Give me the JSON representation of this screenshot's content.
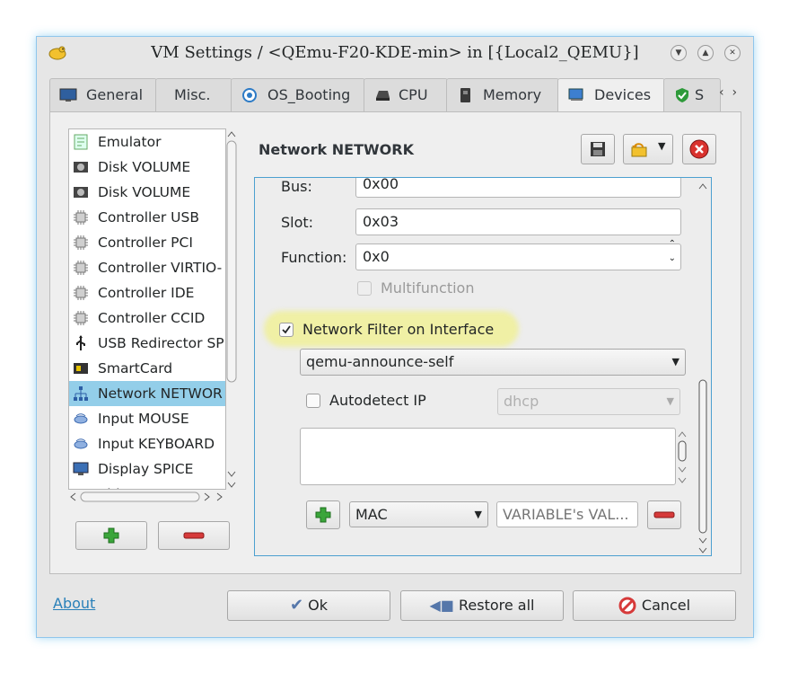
{
  "window": {
    "title": "VM Settings / <QEmu-F20-KDE-min> in [{Local2_QEMU}]"
  },
  "tabs": [
    {
      "label": "General",
      "icon": "monitor-icon"
    },
    {
      "label": "Misc.",
      "icon": "none"
    },
    {
      "label": "OS_Booting",
      "icon": "boot-icon"
    },
    {
      "label": "CPU",
      "icon": "cpu-icon"
    },
    {
      "label": "Memory",
      "icon": "memory-icon"
    },
    {
      "label": "Devices",
      "icon": "devices-icon",
      "active": true
    },
    {
      "label": "S",
      "icon": "shield-icon"
    }
  ],
  "devices": [
    {
      "label": "Emulator",
      "icon": "emulator-icon"
    },
    {
      "label": "Disk VOLUME",
      "icon": "disk-icon"
    },
    {
      "label": "Disk VOLUME",
      "icon": "disk-icon"
    },
    {
      "label": "Controller USB",
      "icon": "controller-icon"
    },
    {
      "label": "Controller PCI",
      "icon": "controller-icon"
    },
    {
      "label": "Controller VIRTIO-",
      "icon": "controller-icon"
    },
    {
      "label": "Controller IDE",
      "icon": "controller-icon"
    },
    {
      "label": "Controller CCID",
      "icon": "controller-icon"
    },
    {
      "label": "USB Redirector SP",
      "icon": "usb-icon"
    },
    {
      "label": "SmartCard",
      "icon": "smartcard-icon"
    },
    {
      "label": "Network NETWOR",
      "icon": "network-icon",
      "selected": true
    },
    {
      "label": "Input MOUSE",
      "icon": "input-icon"
    },
    {
      "label": "Input KEYBOARD",
      "icon": "input-icon"
    },
    {
      "label": "Display SPICE",
      "icon": "display-icon"
    },
    {
      "label": "Video QXL",
      "icon": "video-icon"
    }
  ],
  "editor": {
    "header": "Network NETWORK",
    "bus_label": "Bus:",
    "bus_value": "0x00",
    "slot_label": "Slot:",
    "slot_value": "0x03",
    "function_label": "Function:",
    "function_value": "0x0",
    "multifunction_label": "Multifunction",
    "filter_label": "Network Filter on Interface",
    "filter_checked": true,
    "filter_value": "qemu-announce-self",
    "autodetect_label": "Autodetect IP",
    "autodetect_value": "dhcp",
    "param_name": "MAC",
    "param_placeholder": "VARIABLE's VAL..."
  },
  "footer": {
    "about": "About",
    "ok": "Ok",
    "restore": "Restore all",
    "cancel": "Cancel"
  },
  "colors": {
    "accent": "#3daee9",
    "selection": "#93cee9",
    "highlight": "#f0f0a0",
    "add_green": "#3aa53a",
    "remove_red": "#d63a3a"
  }
}
